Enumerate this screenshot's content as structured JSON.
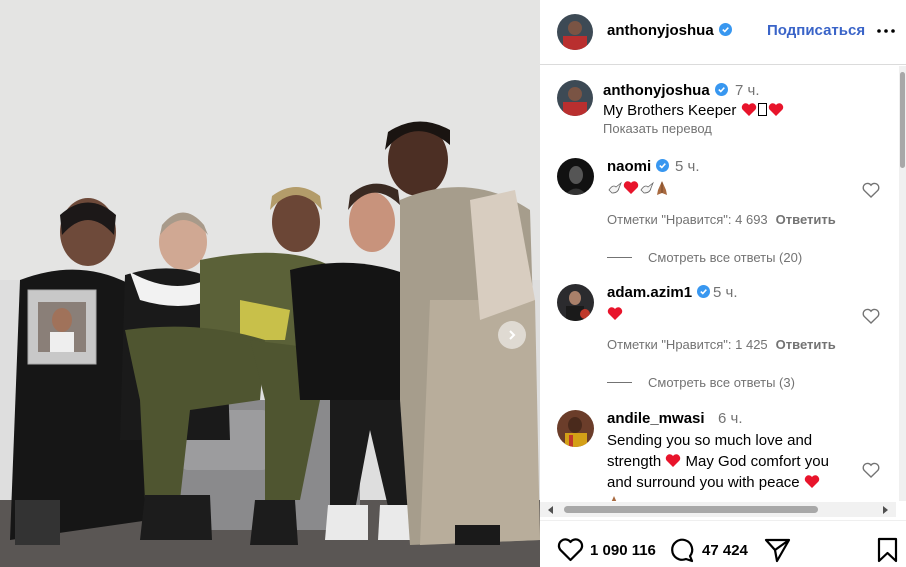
{
  "post": {
    "username": "anthonyjoshua",
    "follow_label": "Подписаться",
    "caption_time": "7 ч.",
    "caption_text": "My Brothers Keeper",
    "show_translation": "Показать перевод"
  },
  "comments": [
    {
      "username": "naomi",
      "time": "5 ч.",
      "likes_text": "Отметки \"Нравится\": 4 693",
      "reply_label": "Ответить",
      "view_replies": "Смотреть все ответы (20)"
    },
    {
      "username": "adam.azim1",
      "time": "5 ч.",
      "likes_text": "Отметки \"Нравится\": 1 425",
      "reply_label": "Ответить",
      "view_replies": "Смотреть все ответы (3)"
    },
    {
      "username": "andile_mwasi",
      "time": "6 ч.",
      "text_line1": "Sending you so much love and",
      "text_line2": "strength",
      "text_line2b": "May God comfort you",
      "text_line3": "and surround you with peace"
    }
  ],
  "actions": {
    "likes_count": "1 090 116",
    "comments_count": "47 424"
  },
  "icons": {
    "verified": "verified-badge-icon",
    "more": "more-options-icon",
    "like": "heart-outline-icon",
    "comment": "comment-bubble-icon",
    "share": "paper-plane-icon",
    "save": "bookmark-icon",
    "next": "chevron-right-icon"
  },
  "colors": {
    "follow": "#3a64c8",
    "verified": "#3897f0",
    "heart_emoji": "#e8142b",
    "secondary_text": "#737373"
  }
}
